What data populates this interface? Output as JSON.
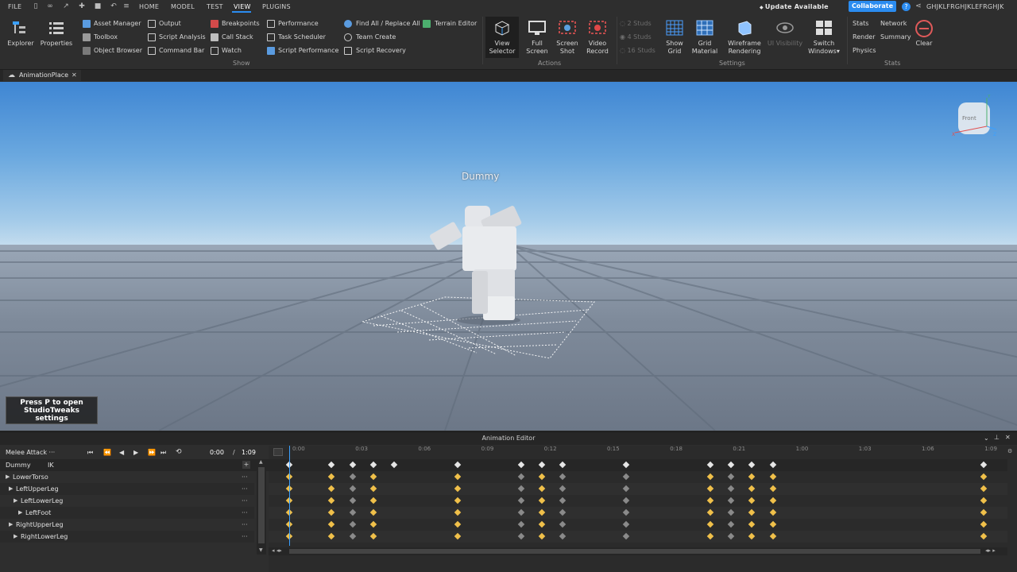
{
  "menubar": {
    "file": "FILE",
    "tabs": [
      "HOME",
      "MODEL",
      "TEST",
      "VIEW",
      "PLUGINS"
    ],
    "active_tab": "VIEW",
    "update": "Update Available",
    "collaborate": "Collaborate",
    "user": "GHJKLFRGHJKLEFRGHJK"
  },
  "ribbon": {
    "explorer": "Explorer",
    "properties": "Properties",
    "show_col1": [
      "Asset Manager",
      "Toolbox",
      "Object Browser"
    ],
    "show_col2": [
      "Output",
      "Script Analysis",
      "Command Bar"
    ],
    "show_col3": [
      "Breakpoints",
      "Call Stack",
      "Watch"
    ],
    "show_col4": [
      "Performance",
      "Task Scheduler",
      "Script Performance"
    ],
    "show_col5": [
      "Find All / Replace All",
      "Team Create",
      "Script Recovery"
    ],
    "terrain_editor": "Terrain Editor",
    "show_label": "Show",
    "actions": [
      {
        "l1": "View",
        "l2": "Selector"
      },
      {
        "l1": "Full",
        "l2": "Screen"
      },
      {
        "l1": "Screen",
        "l2": "Shot"
      },
      {
        "l1": "Video",
        "l2": "Record"
      }
    ],
    "actions_label": "Actions",
    "studs": [
      "2 Studs",
      "4 Studs",
      "16 Studs"
    ],
    "settings_big": [
      {
        "l1": "Show",
        "l2": "Grid"
      },
      {
        "l1": "Grid",
        "l2": "Material"
      },
      {
        "l1": "Wireframe",
        "l2": "Rendering"
      },
      {
        "l1": "UI Visibility",
        "l2": ""
      },
      {
        "l1": "Switch",
        "l2": "Windows"
      }
    ],
    "settings_label": "Settings",
    "stats_col1": [
      "Stats",
      "Render",
      "Physics"
    ],
    "stats_col2": [
      "Network",
      "Summary"
    ],
    "clear": "Clear",
    "stats_label": "Stats"
  },
  "tab": {
    "title": "AnimationPlace"
  },
  "viewport": {
    "dummy_label": "Dummy",
    "studiotweaks": [
      "Press P to open",
      "StudioTweaks",
      "settings"
    ],
    "viewcube_label": "Front"
  },
  "anim_editor": {
    "title": "Animation Editor",
    "animation_name": "Melee Attack",
    "current_time": "0:00",
    "separator": "/",
    "end_time": "1:09",
    "rig": "Dummy",
    "ik": "IK",
    "tracks": [
      "LowerTorso",
      "LeftUpperLeg",
      "LeftLowerLeg",
      "LeftFoot",
      "RightUpperLeg",
      "RightLowerLeg"
    ],
    "ticks": [
      "0:00",
      "0:03",
      "0:06",
      "0:09",
      "0:12",
      "0:15",
      "0:18",
      "0:21",
      "1:00",
      "1:03",
      "1:06",
      "1:09"
    ],
    "colors": {
      "key_white": "#e6e6e6",
      "key_gold": "#f0c04a",
      "key_gray": "#8a8a8a",
      "playhead": "#3aa0ff",
      "accent": "#2b8cf0"
    }
  }
}
